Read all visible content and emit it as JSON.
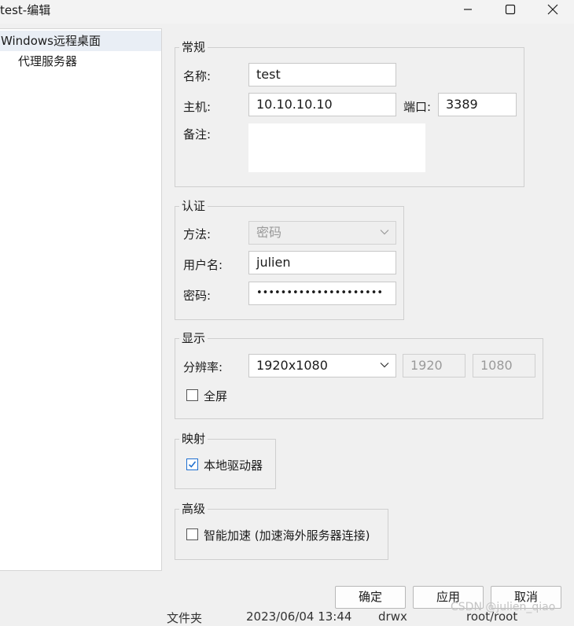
{
  "window": {
    "title": "test-编辑"
  },
  "sidebar": {
    "items": [
      {
        "label": "Windows远程桌面"
      },
      {
        "label": "代理服务器"
      }
    ]
  },
  "general": {
    "legend": "常规",
    "name_label": "名称:",
    "name_value": "test",
    "host_label": "主机:",
    "host_value": "10.10.10.10",
    "port_label": "端口:",
    "port_value": "3389",
    "note_label": "备注:"
  },
  "auth": {
    "legend": "认证",
    "method_label": "方法:",
    "method_value": "密码",
    "username_label": "用户名:",
    "username_value": "julien",
    "password_label": "密码:",
    "password_mask": "•••••••••••••••••••••"
  },
  "display": {
    "legend": "显示",
    "resolution_label": "分辨率:",
    "resolution_value": "1920x1080",
    "width_value": "1920",
    "height_value": "1080",
    "fullscreen_label": "全屏",
    "fullscreen_checked": false
  },
  "mapping": {
    "legend": "映射",
    "local_drives_label": "本地驱动器",
    "local_drives_checked": true
  },
  "advanced": {
    "legend": "高级",
    "smart_accel_label": "智能加速 (加速海外服务器连接)",
    "smart_accel_checked": false
  },
  "footer": {
    "ok_label": "确定",
    "apply_label": "应用",
    "cancel_label": "取消"
  },
  "background_row": {
    "type": "文件夹",
    "date": "2023/06/04 13:44",
    "perm": "drwx",
    "owner": "root/root"
  },
  "watermark": "CSDN @julien_qiao",
  "colors": {
    "checkbox_accent": "#1e6fd0",
    "sidebar_selected": "#e9eef5"
  }
}
